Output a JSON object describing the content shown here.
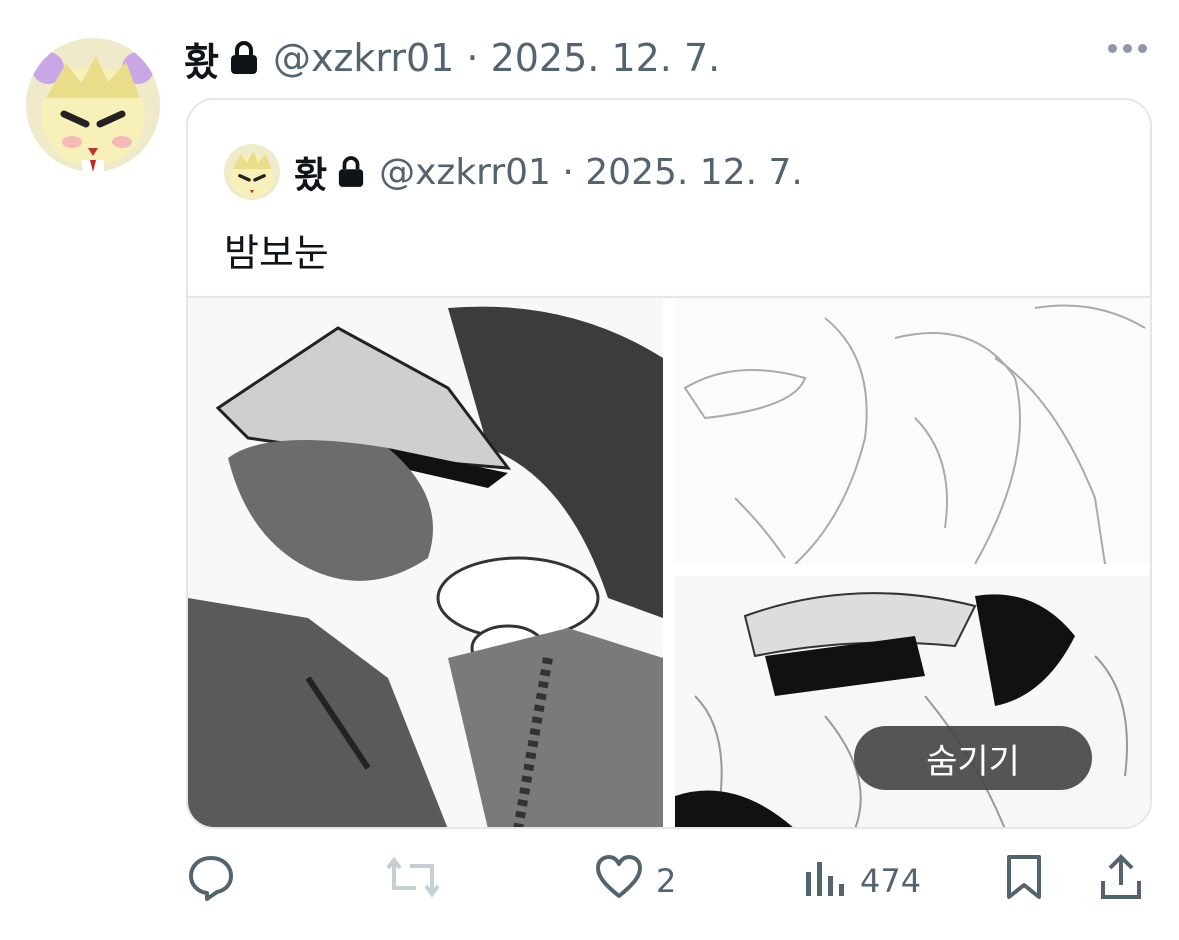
{
  "tweet": {
    "author_name": "홨",
    "handle_date": "@xzkrr01 · 2025. 12. 7.",
    "icons": {
      "lock": "lock-icon",
      "more": "more-dots-icon"
    }
  },
  "quoted": {
    "author_name": "홨",
    "handle_date": "@xzkrr01 · 2025. 12. 7.",
    "text": "밤보눈",
    "hide_label": "숨기기"
  },
  "actions": {
    "reply": {
      "icon": "reply-icon"
    },
    "retweet": {
      "icon": "retweet-icon"
    },
    "like": {
      "icon": "heart-icon",
      "count": "2"
    },
    "views": {
      "icon": "views-icon",
      "count": "474"
    },
    "bookmark": {
      "icon": "bookmark-icon"
    },
    "share": {
      "icon": "share-icon"
    }
  },
  "colors": {
    "text": "#0f1419",
    "muted": "#536471",
    "border": "#e1e8ed"
  }
}
